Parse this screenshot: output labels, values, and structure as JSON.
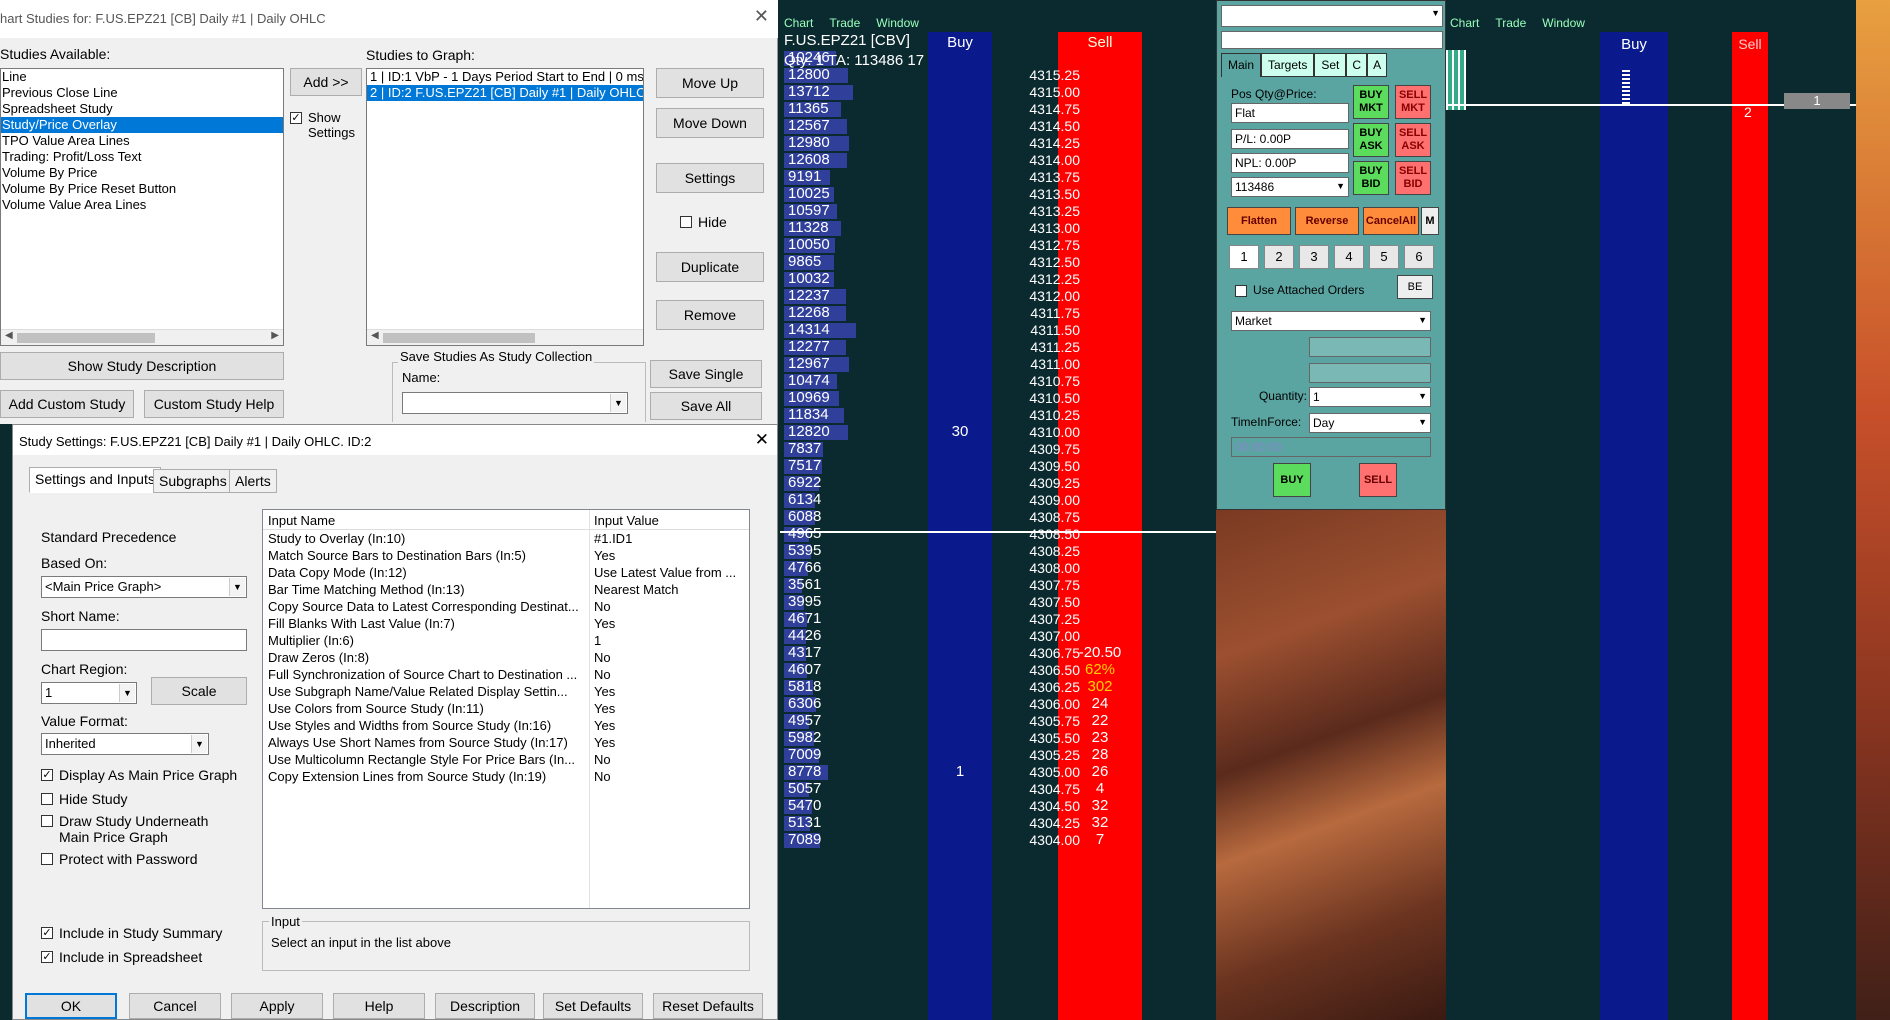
{
  "studies_dialog": {
    "title": "hart Studies for: F.US.EPZ21 [CB]  Daily  #1 | Daily OHLC",
    "available_label": "Studies Available:",
    "available_items": [
      "Line",
      "Previous Close Line",
      "Spreadsheet Study",
      "Study/Price Overlay",
      "TPO Value Area Lines",
      "Trading: Profit/Loss Text",
      "Volume By Price",
      "Volume By Price Reset Button",
      "Volume Value Area Lines"
    ],
    "selected_available": "Study/Price Overlay",
    "add_button": "Add >>",
    "show_settings": "Show Settings",
    "to_graph_label": "Studies to Graph:",
    "to_graph_items": [
      "1 | ID:1  VbP - 1 Days Period Start to End | 0 ms",
      "2 | ID:2  F.US.EPZ21 [CB]  Daily  #1 | Daily OHLC"
    ],
    "move_up": "Move Up",
    "move_down": "Move Down",
    "settings": "Settings",
    "hide": "Hide",
    "duplicate": "Duplicate",
    "remove": "Remove",
    "show_description": "Show Study Description",
    "add_custom": "Add Custom Study",
    "custom_help": "Custom Study Help",
    "save_collection_label": "Save Studies As Study Collection",
    "name_label": "Name:",
    "save_single": "Save Single",
    "save_all": "Save All"
  },
  "settings_dialog": {
    "title": "Study Settings: F.US.EPZ21 [CB]  Daily  #1 | Daily OHLC. ID:2",
    "tabs": [
      "Settings and Inputs",
      "Subgraphs",
      "Alerts"
    ],
    "standard_precedence": "Standard Precedence",
    "based_on_label": "Based On:",
    "based_on_value": "<Main Price Graph>",
    "short_name_label": "Short Name:",
    "chart_region_label": "Chart Region:",
    "chart_region_value": "1",
    "scale": "Scale",
    "value_format_label": "Value Format:",
    "value_format_value": "Inherited",
    "opt_main_price": "Display As Main Price Graph",
    "opt_hide": "Hide Study",
    "opt_underneath": "Draw Study Underneath Main Price Graph",
    "opt_password": "Protect with Password",
    "opt_summary": "Include in Study Summary",
    "opt_spreadsheet": "Include in Spreadsheet",
    "grid_headers": [
      "Input Name",
      "Input Value"
    ],
    "inputs": [
      {
        "name": "Study to Overlay  (In:10)",
        "value": "#1.ID1"
      },
      {
        "name": "Match Source Bars to Destination Bars  (In:5)",
        "value": "Yes"
      },
      {
        "name": "Data Copy Mode  (In:12)",
        "value": "Use Latest Value from ..."
      },
      {
        "name": "Bar Time Matching Method  (In:13)",
        "value": "Nearest Match"
      },
      {
        "name": "Copy Source Data to Latest Corresponding Destinat...",
        "value": "No"
      },
      {
        "name": "Fill Blanks With Last Value  (In:7)",
        "value": "Yes"
      },
      {
        "name": "Multiplier  (In:6)",
        "value": "1"
      },
      {
        "name": "Draw Zeros  (In:8)",
        "value": "No"
      },
      {
        "name": "Full Synchronization of Source Chart to Destination  ...",
        "value": "No"
      },
      {
        "name": "Use Subgraph Name/Value Related Display Settin...",
        "value": "Yes"
      },
      {
        "name": "Use Colors from Source Study  (In:11)",
        "value": "Yes"
      },
      {
        "name": "Use Styles and Widths from Source Study  (In:16)",
        "value": "Yes"
      },
      {
        "name": "Always Use Short Names from Source Study  (In:17)",
        "value": "Yes"
      },
      {
        "name": "Use Multicolumn Rectangle Style For Price Bars  (In...",
        "value": "No"
      },
      {
        "name": "Copy Extension Lines from Source Study  (In:19)",
        "value": "No"
      }
    ],
    "input_group": "Input",
    "input_hint": "Select an input in the list above",
    "buttons": [
      "OK",
      "Cancel",
      "Apply",
      "Help",
      "Description",
      "Set Defaults",
      "Reset Defaults"
    ]
  },
  "dom_left": {
    "menu": [
      "Chart",
      "Trade",
      "Window"
    ],
    "symbol": "F.US.EPZ21 [CBV]",
    "qty_line": "Qty: 1  TA: 113486  17",
    "buy_header": "Buy",
    "sell_header": "Sell",
    "rows": [
      {
        "q": "10246",
        "p": "",
        "s": "",
        "b": ""
      },
      {
        "q": "12800",
        "p": "4315.25",
        "s": "",
        "b": ""
      },
      {
        "q": "13712",
        "p": "4315.00",
        "s": "",
        "b": ""
      },
      {
        "q": "11365",
        "p": "4314.75",
        "s": "",
        "b": ""
      },
      {
        "q": "12567",
        "p": "4314.50",
        "s": "",
        "b": ""
      },
      {
        "q": "12980",
        "p": "4314.25",
        "s": "",
        "b": ""
      },
      {
        "q": "12608",
        "p": "4314.00",
        "s": "",
        "b": ""
      },
      {
        "q": "9191",
        "p": "4313.75",
        "s": "",
        "b": ""
      },
      {
        "q": "10025",
        "p": "4313.50",
        "s": "",
        "b": ""
      },
      {
        "q": "10597",
        "p": "4313.25",
        "s": "",
        "b": ""
      },
      {
        "q": "11328",
        "p": "4313.00",
        "s": "",
        "b": ""
      },
      {
        "q": "10050",
        "p": "4312.75",
        "s": "",
        "b": ""
      },
      {
        "q": "9865",
        "p": "4312.50",
        "s": "",
        "b": ""
      },
      {
        "q": "10032",
        "p": "4312.25",
        "s": "",
        "b": ""
      },
      {
        "q": "12237",
        "p": "4312.00",
        "s": "",
        "b": ""
      },
      {
        "q": "12268",
        "p": "4311.75",
        "s": "",
        "b": ""
      },
      {
        "q": "14314",
        "p": "4311.50",
        "s": "",
        "b": ""
      },
      {
        "q": "12277",
        "p": "4311.25",
        "s": "",
        "b": ""
      },
      {
        "q": "12967",
        "p": "4311.00",
        "s": "",
        "b": ""
      },
      {
        "q": "10474",
        "p": "4310.75",
        "s": "",
        "b": ""
      },
      {
        "q": "10969",
        "p": "4310.50",
        "s": "",
        "b": ""
      },
      {
        "q": "11834",
        "p": "4310.25",
        "s": "",
        "b": ""
      },
      {
        "q": "12820",
        "p": "4310.00",
        "s": "",
        "b": "30"
      },
      {
        "q": "7837",
        "p": "4309.75",
        "s": "",
        "b": ""
      },
      {
        "q": "7517",
        "p": "4309.50",
        "s": "",
        "b": ""
      },
      {
        "q": "6922",
        "p": "4309.25",
        "s": "",
        "b": ""
      },
      {
        "q": "6134",
        "p": "4309.00",
        "s": "",
        "b": ""
      },
      {
        "q": "6088",
        "p": "4308.75",
        "s": "",
        "b": ""
      },
      {
        "q": "4965",
        "p": "4308.50",
        "s": "",
        "b": ""
      },
      {
        "q": "5395",
        "p": "4308.25",
        "s": "",
        "b": ""
      },
      {
        "q": "4766",
        "p": "4308.00",
        "s": "",
        "b": ""
      },
      {
        "q": "3561",
        "p": "4307.75",
        "s": "",
        "b": ""
      },
      {
        "q": "3995",
        "p": "4307.50",
        "s": "",
        "b": ""
      },
      {
        "q": "4671",
        "p": "4307.25",
        "s": "",
        "b": ""
      },
      {
        "q": "4426",
        "p": "4307.00",
        "s": "",
        "b": ""
      },
      {
        "q": "4317",
        "p": "4306.75",
        "s": "-20.50",
        "b": ""
      },
      {
        "q": "4607",
        "p": "4306.50",
        "s": "62%",
        "b": ""
      },
      {
        "q": "5818",
        "p": "4306.25",
        "s": "302",
        "b": ""
      },
      {
        "q": "6306",
        "p": "4306.00",
        "s": "24",
        "b": ""
      },
      {
        "q": "4957",
        "p": "4305.75",
        "s": "22",
        "b": ""
      },
      {
        "q": "5982",
        "p": "4305.50",
        "s": "23",
        "b": ""
      },
      {
        "q": "7009",
        "p": "4305.25",
        "s": "28",
        "b": ""
      },
      {
        "q": "8778",
        "p": "4305.00",
        "s": "26",
        "b": "1"
      },
      {
        "q": "5057",
        "p": "4304.75",
        "s": "4",
        "b": ""
      },
      {
        "q": "5470",
        "p": "4304.50",
        "s": "32",
        "b": ""
      },
      {
        "q": "5131",
        "p": "4304.25",
        "s": "32",
        "b": ""
      },
      {
        "q": "7089",
        "p": "4304.00",
        "s": "7",
        "b": ""
      }
    ]
  },
  "trade_panel": {
    "tabs": [
      "Main",
      "Targets",
      "Set",
      "C",
      "A"
    ],
    "pos_label": "Pos Qty@Price:",
    "pos_value": "Flat",
    "pl": "P/L: 0.00P",
    "npl": "NPL: 0.00P",
    "account": "113486",
    "buy_mkt": "BUY MKT",
    "sell_mkt": "SELL MKT",
    "buy_ask": "BUY ASK",
    "sell_ask": "SELL ASK",
    "buy_bid": "BUY BID",
    "sell_bid": "SELL BID",
    "flatten": "Flatten",
    "reverse": "Reverse",
    "cancel_all": "CancelAll",
    "m": "M",
    "qty_buttons": [
      "1",
      "2",
      "3",
      "4",
      "5",
      "6"
    ],
    "attached": "Use Attached Orders",
    "be": "BE",
    "order_type": "Market",
    "quantity_label": "Quantity:",
    "quantity": "1",
    "tif_label": "TimeInForce:",
    "tif": "Day",
    "time": "00:00:00",
    "buy": "BUY",
    "sell": "SELL"
  },
  "dom_right": {
    "menu": [
      "Chart",
      "Trade",
      "Window"
    ],
    "buy_header": "Buy",
    "sell_header": "Sell",
    "pos_qty": "1",
    "sell_mark": "2"
  },
  "colors": {
    "buy_col": "#0a1a8c",
    "sell_col": "#ff0000",
    "qty_bar": "#2f3f9a",
    "bg": "#0b2a2f"
  }
}
